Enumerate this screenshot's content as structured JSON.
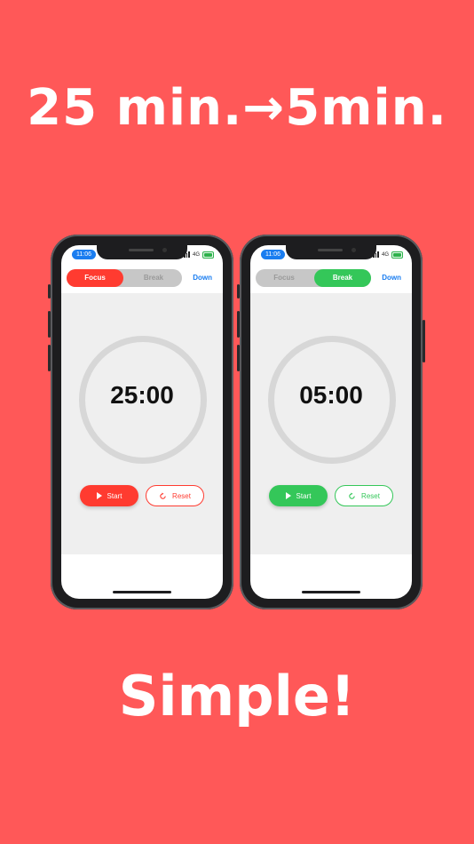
{
  "headline": "25 min.→5min.",
  "footer": "Simple!",
  "phones": [
    {
      "status_time": "11:06",
      "network": "4G",
      "tabs": [
        "Focus",
        "Break"
      ],
      "active_tab": "Focus",
      "down_label": "Down",
      "timer": "25:00",
      "start_label": "Start",
      "reset_label": "Reset",
      "accent": "#FF3B30"
    },
    {
      "status_time": "11:06",
      "network": "4G",
      "tabs": [
        "Focus",
        "Break"
      ],
      "active_tab": "Break",
      "down_label": "Down",
      "timer": "05:00",
      "start_label": "Start",
      "reset_label": "Reset",
      "accent": "#34C759"
    }
  ],
  "colors": {
    "background": "#FF5858",
    "link": "#1A7DF0",
    "segment_inactive": "#C7C7C7",
    "ring": "#D7D7D7",
    "screen_body": "#EFEFEF"
  },
  "icons": [
    "play-icon",
    "reset-icon",
    "signal-icon",
    "battery-icon"
  ]
}
